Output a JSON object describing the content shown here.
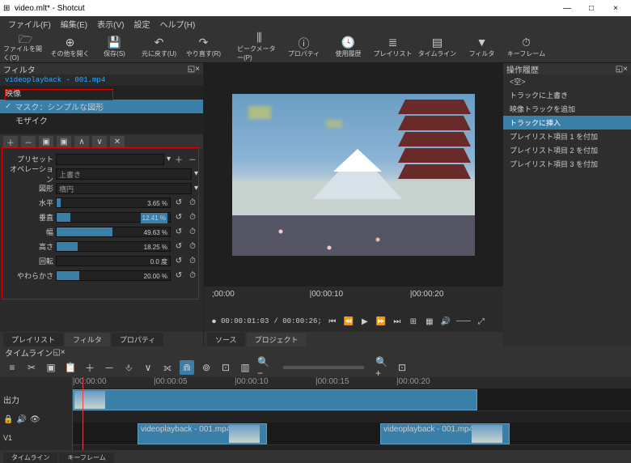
{
  "window": {
    "title": "video.mlt* - Shotcut",
    "min": "—",
    "max": "□",
    "close": "×"
  },
  "menu": {
    "file": "ファイル(F)",
    "edit": "編集(E)",
    "view": "表示(V)",
    "settings": "設定",
    "help": "ヘルプ(H)"
  },
  "toolbar": [
    {
      "icon": "🗁",
      "label": "ファイルを開く(O)"
    },
    {
      "icon": "⊕",
      "label": "その他を開く"
    },
    {
      "icon": "💾",
      "label": "保存(S)"
    },
    {
      "icon": "↶",
      "label": "元に戻す(U)"
    },
    {
      "icon": "↷",
      "label": "やり直す(R)"
    },
    {
      "icon": "⫼",
      "label": "ピークメーター(P)"
    },
    {
      "icon": "ⓘ",
      "label": "プロパティ"
    },
    {
      "icon": "🕓",
      "label": "使用履歴"
    },
    {
      "icon": "≣",
      "label": "プレイリスト"
    },
    {
      "icon": "▤",
      "label": "タイムライン"
    },
    {
      "icon": "▼",
      "label": "フィルタ"
    },
    {
      "icon": "⏱",
      "label": "キーフレーム"
    }
  ],
  "filters": {
    "title": "フィルタ",
    "filename": "videoplayback - 001.mp4",
    "category": "映像",
    "item1": "マスク：シンプルな図形",
    "item2": "モザイク"
  },
  "ftb": {
    "add": "＋",
    "remove": "－",
    "copy": "▣",
    "paste": "▣",
    "up": "∧",
    "down": "∨",
    "clear": "✕"
  },
  "props": {
    "preset": {
      "label": "プリセット",
      "value": ""
    },
    "operation": {
      "label": "オペレーション",
      "value": "上書き"
    },
    "shape": {
      "label": "図形",
      "value": "楕円"
    },
    "horizontal": {
      "label": "水平",
      "pct": 3.65,
      "text": "3.65 %"
    },
    "vertical": {
      "label": "垂直",
      "pct": 12.41,
      "text": "12.41 %",
      "hl": true
    },
    "width": {
      "label": "幅",
      "pct": 49.63,
      "text": "49.63 %"
    },
    "height": {
      "label": "高さ",
      "pct": 18.25,
      "text": "18.25 %"
    },
    "rotate": {
      "label": "回転",
      "pct": 0,
      "text": "0.0 度"
    },
    "soft": {
      "label": "やわらかさ",
      "pct": 20,
      "text": "20.00 %"
    }
  },
  "lefttabs": {
    "playlist": "プレイリスト",
    "filters": "フィルタ",
    "properties": "プロパティ"
  },
  "player": {
    "ruler": {
      "t0": ";00:00",
      "t1": "|00:00:10",
      "t2": "|00:00:20"
    },
    "pos": "00:00:01:03",
    "dur": "/ 00:00:26;",
    "tabs": {
      "source": "ソース",
      "project": "プロジェクト"
    }
  },
  "history": {
    "title": "操作履歴",
    "empty": "<空>",
    "i1": "トラックに上書き",
    "i2": "映像トラックを追加",
    "i3": "トラックに挿入",
    "i4": "プレイリスト項目 1 を付加",
    "i5": "プレイリスト項目 2 を付加",
    "i6": "プレイリスト項目 3 を付加"
  },
  "timeline": {
    "title": "タイムライン",
    "output": "出力",
    "v1": "V1",
    "ruler": {
      "t0": "|00:00:00",
      "t1": "|00:00:05",
      "t2": "|00:00:10",
      "t3": "|00:00:15",
      "t4": "|00:00:20"
    },
    "clip1": "videoplayback - 001.mp4",
    "clip2": "videoplayback - 001.mp4",
    "tabs": {
      "tl": "タイムライン",
      "kf": "キーフレーム"
    }
  }
}
